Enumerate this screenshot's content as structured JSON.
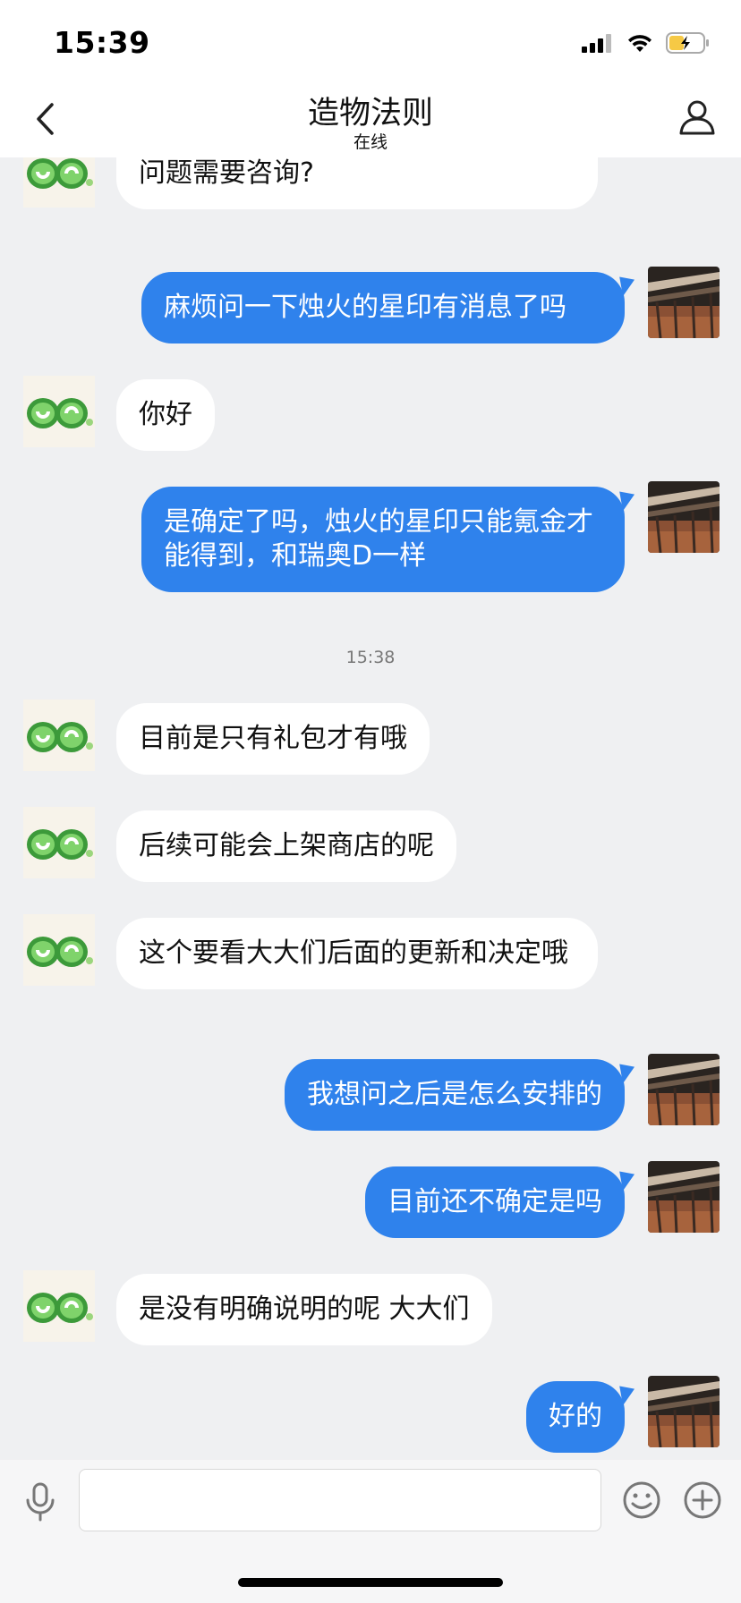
{
  "status_bar": {
    "time": "15:39"
  },
  "header": {
    "title": "造物法则",
    "subtitle": "在线"
  },
  "conversation": {
    "messages": [
      {
        "side": "in",
        "text": "您好，很高兴为您服务！请问有什么问题需要咨询?"
      },
      {
        "side": "out",
        "text": "麻烦问一下烛火的星印有消息了吗"
      },
      {
        "side": "in",
        "text": "你好"
      },
      {
        "side": "out",
        "text": "是确定了吗，烛火的星印只能氪金才能得到，和瑞奥D一样"
      },
      {
        "side": "timestamp",
        "text": "15:38"
      },
      {
        "side": "in",
        "text": "目前是只有礼包才有哦"
      },
      {
        "side": "in",
        "text": "后续可能会上架商店的呢"
      },
      {
        "side": "in",
        "text": "这个要看大大们后面的更新和决定哦"
      },
      {
        "side": "out",
        "text": "我想问之后是怎么安排的"
      },
      {
        "side": "out",
        "text": "目前还不确定是吗"
      },
      {
        "side": "in",
        "text": "是没有明确说明的呢 大大们"
      },
      {
        "side": "out",
        "text": "好的"
      }
    ]
  },
  "input_bar": {
    "value": "",
    "placeholder": ""
  },
  "icons": {
    "back": "chevron-left-icon",
    "profile": "person-icon",
    "mic": "microphone-icon",
    "emoji": "smiley-icon",
    "plus": "plus-circle-icon",
    "agent_avatar": "green-60-logo",
    "user_avatar": "bridge-photo"
  },
  "colors": {
    "outgoing_bubble": "#2f82ec",
    "incoming_bubble": "#ffffff",
    "background": "#eff0f2",
    "battery_fill": "#f6c945"
  }
}
